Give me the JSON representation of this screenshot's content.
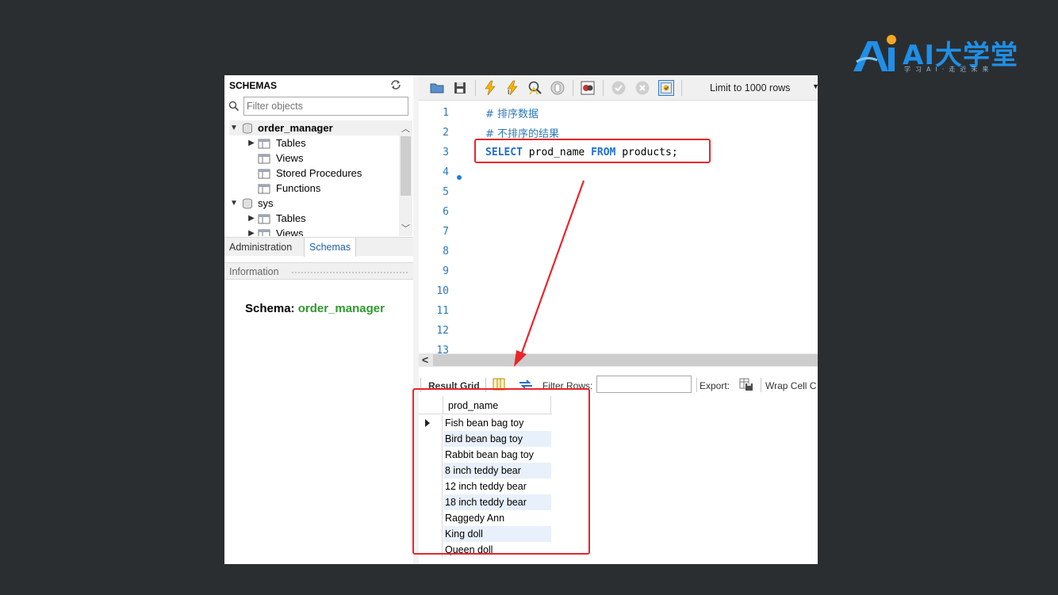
{
  "logo": {
    "text": "AI大学堂",
    "subtitle": "学习AI·走近未来"
  },
  "navigator": {
    "title": "SCHEMAS",
    "filter_placeholder": "Filter objects",
    "tree": [
      {
        "label": "order_manager",
        "kind": "schema",
        "expanded": true,
        "bold": true
      },
      {
        "label": "Tables",
        "kind": "folder",
        "expandable": true
      },
      {
        "label": "Views",
        "kind": "folder"
      },
      {
        "label": "Stored Procedures",
        "kind": "folder"
      },
      {
        "label": "Functions",
        "kind": "folder"
      },
      {
        "label": "sys",
        "kind": "schema",
        "expanded": true
      },
      {
        "label": "Tables",
        "kind": "folder",
        "expandable": true
      },
      {
        "label": "Views",
        "kind": "folder",
        "expandable": true
      }
    ],
    "tabs": [
      "Administration",
      "Schemas"
    ],
    "active_tab": "Schemas",
    "info_title": "Information",
    "schema_label": "Schema:",
    "schema_value": "order_manager"
  },
  "toolbar": {
    "icons": [
      "open-folder-icon",
      "save-icon",
      "execute-icon",
      "execute-current-icon",
      "explain-icon",
      "stop-icon",
      "toggle-errors-icon",
      "commit-icon",
      "rollback-icon",
      "autocommit-icon"
    ],
    "limit_label": "Limit to 1000 rows"
  },
  "editor": {
    "line_numbers": [
      "1",
      "2",
      "3",
      "4",
      "5",
      "6",
      "7",
      "8",
      "9",
      "10",
      "11",
      "12",
      "13"
    ],
    "line1": "# 排序数据",
    "line2": "# 不排序的结果",
    "line3": {
      "kw1": "SELECT",
      "t1": " prod_name ",
      "kw2": "FROM",
      "t2": " products;"
    }
  },
  "result_toolbar": {
    "result_grid": "Result Grid",
    "filter_rows": "Filter Rows:",
    "export": "Export:",
    "wrap": "Wrap Cell C"
  },
  "result_grid": {
    "column": "prod_name",
    "rows": [
      "Fish bean bag toy",
      "Bird bean bag toy",
      "Rabbit bean bag toy",
      "8 inch teddy bear",
      "12 inch teddy bear",
      "18 inch teddy bear",
      "Raggedy Ann",
      "King doll",
      "Queen doll"
    ]
  },
  "colors": {
    "background": "#2b2e31",
    "highlight": "#e8262b",
    "keyword": "#1f6fd0",
    "comment": "#2b7bb9",
    "schema_value": "#2e9a2e"
  }
}
